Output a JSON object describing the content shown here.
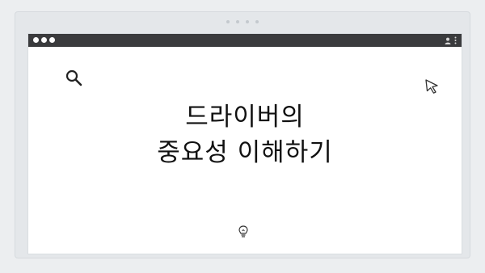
{
  "content": {
    "heading_line1": "드라이버의",
    "heading_line2": "중요성 이해하기"
  },
  "icons": {
    "search": "search-icon",
    "cursor": "cursor-arrow-icon",
    "bulb": "lightbulb-icon",
    "user": "user-icon",
    "menu": "more-vertical-icon"
  },
  "colors": {
    "titlebar": "#3a3b3d",
    "background": "#eceef0",
    "page": "#ffffff",
    "text": "#111111"
  }
}
